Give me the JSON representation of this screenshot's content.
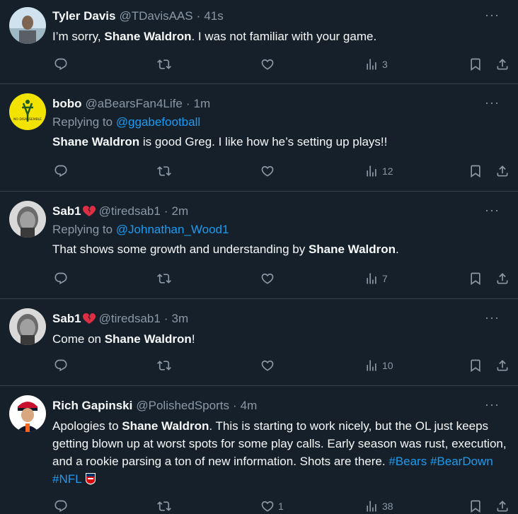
{
  "tweets": [
    {
      "name": "Tyler Davis",
      "handle": "@TDavisAAS",
      "time": "41s",
      "text_before": "I’m sorry, ",
      "text_bold": "Shane Waldron",
      "text_after": ". I was not familiar with your game.",
      "views": "3",
      "likes": ""
    },
    {
      "name": "bobo",
      "handle": "@aBearsFan4Life",
      "time": "1m",
      "replying_prefix": "Replying to ",
      "replying_to": "@ggabefootball",
      "avatar_text": "NO DISASSEMBLE",
      "text_bold": "Shane Waldron",
      "text_after": " is good Greg. I like how he’s setting up plays!!",
      "views": "12"
    },
    {
      "name": "Sab1",
      "handle": "@tiredsab1",
      "time": "2m",
      "replying_prefix": "Replying to ",
      "replying_to": "@Johnathan_Wood1",
      "text_before": "That shows some growth and understanding by ",
      "text_bold": "Shane Waldron",
      "text_after": ".",
      "views": "7"
    },
    {
      "name": "Sab1",
      "handle": "@tiredsab1",
      "time": "3m",
      "text_before": "Come on ",
      "text_bold": "Shane Waldron",
      "text_after": "!",
      "views": "10"
    },
    {
      "name": "Rich Gapinski",
      "handle": "@PolishedSports",
      "time": "4m",
      "text_before": "Apologies to ",
      "text_bold": "Shane Waldron",
      "text_after": ". This is starting to work nicely, but the OL just keeps getting blown up at worst spots for some play calls. Early season was rust, execution, and a rookie parsing a ton of new information. Shots are there. ",
      "hashtags": [
        "#Bears",
        "#BearDown",
        "#NFL"
      ],
      "likes": "1",
      "views": "38"
    }
  ],
  "separator": "·",
  "more_label": "···",
  "icons": [
    "reply-icon",
    "retweet-icon",
    "like-icon",
    "views-icon",
    "bookmark-icon",
    "share-icon",
    "broken-heart-icon",
    "nfl-logo-icon"
  ],
  "colors": {
    "background": "#15202b",
    "text": "#f7f9f9",
    "muted": "#8b98a5",
    "link": "#1d9bf0",
    "divider": "#38444d"
  }
}
